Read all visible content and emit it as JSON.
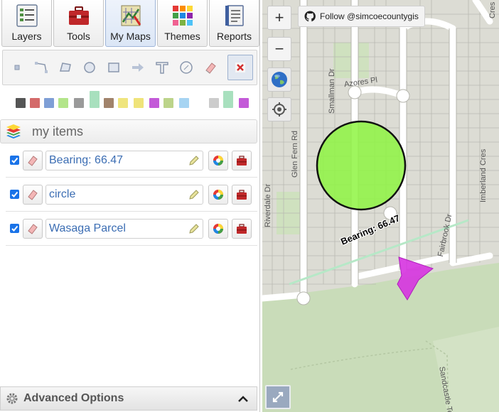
{
  "tabs": [
    {
      "label": "Layers",
      "icon": "layers-list-icon"
    },
    {
      "label": "Tools",
      "icon": "toolbox-icon"
    },
    {
      "label": "My Maps",
      "icon": "map-drawing-icon",
      "active": true
    },
    {
      "label": "Themes",
      "icon": "palette-grid-icon"
    },
    {
      "label": "Reports",
      "icon": "report-binder-icon"
    }
  ],
  "draw_tools": [
    {
      "name": "point-tool",
      "icon": "point-icon"
    },
    {
      "name": "line-tool",
      "icon": "line-icon"
    },
    {
      "name": "polygon-tool",
      "icon": "polygon-icon"
    },
    {
      "name": "circle-tool",
      "icon": "circle-icon"
    },
    {
      "name": "rectangle-tool",
      "icon": "rectangle-icon"
    },
    {
      "name": "arrow-tool",
      "icon": "arrow-icon"
    },
    {
      "name": "text-tool",
      "icon": "text-icon"
    },
    {
      "name": "bearing-tool",
      "icon": "compass-icon"
    },
    {
      "name": "eraser-tool",
      "icon": "eraser-icon"
    },
    {
      "name": "delete-tool",
      "icon": "delete-x-icon",
      "selected": true
    }
  ],
  "swatch_colors": [
    "#555555",
    "#d46a6a",
    "#7f9fd6",
    "#b3e58a",
    "#9a9a9a",
    "#a8e0be",
    "#a1836b",
    "#efe57e",
    "#efe37a",
    "#c35ad8",
    "#bcd48a",
    "#a6d4f2",
    "#cccccc",
    "#a8e0be",
    "#c35ad8"
  ],
  "my_items": {
    "title": "my items",
    "items": [
      {
        "name": "Bearing: 66.47",
        "checked": true
      },
      {
        "name": "circle",
        "checked": true
      },
      {
        "name": "Wasaga Parcel",
        "checked": true
      }
    ]
  },
  "advanced_options": {
    "label": "Advanced Options"
  },
  "map": {
    "zoom_in": "+",
    "zoom_out": "−",
    "github_label": "Follow @simcoecountygis",
    "bearing_label": "Bearing: 66.47",
    "circle_color": "#8ef542",
    "polygon_color": "#d633e0",
    "streets": [
      {
        "name": "Azores Pl"
      },
      {
        "name": "Smallman Dr"
      },
      {
        "name": "Glen Fern Rd"
      },
      {
        "name": "Riverdale Dr"
      },
      {
        "name": "Imberland Cres"
      },
      {
        "name": "Fairbrook Dr"
      },
      {
        "name": "Cres"
      },
      {
        "name": "Sandcastle Tewn"
      }
    ]
  }
}
